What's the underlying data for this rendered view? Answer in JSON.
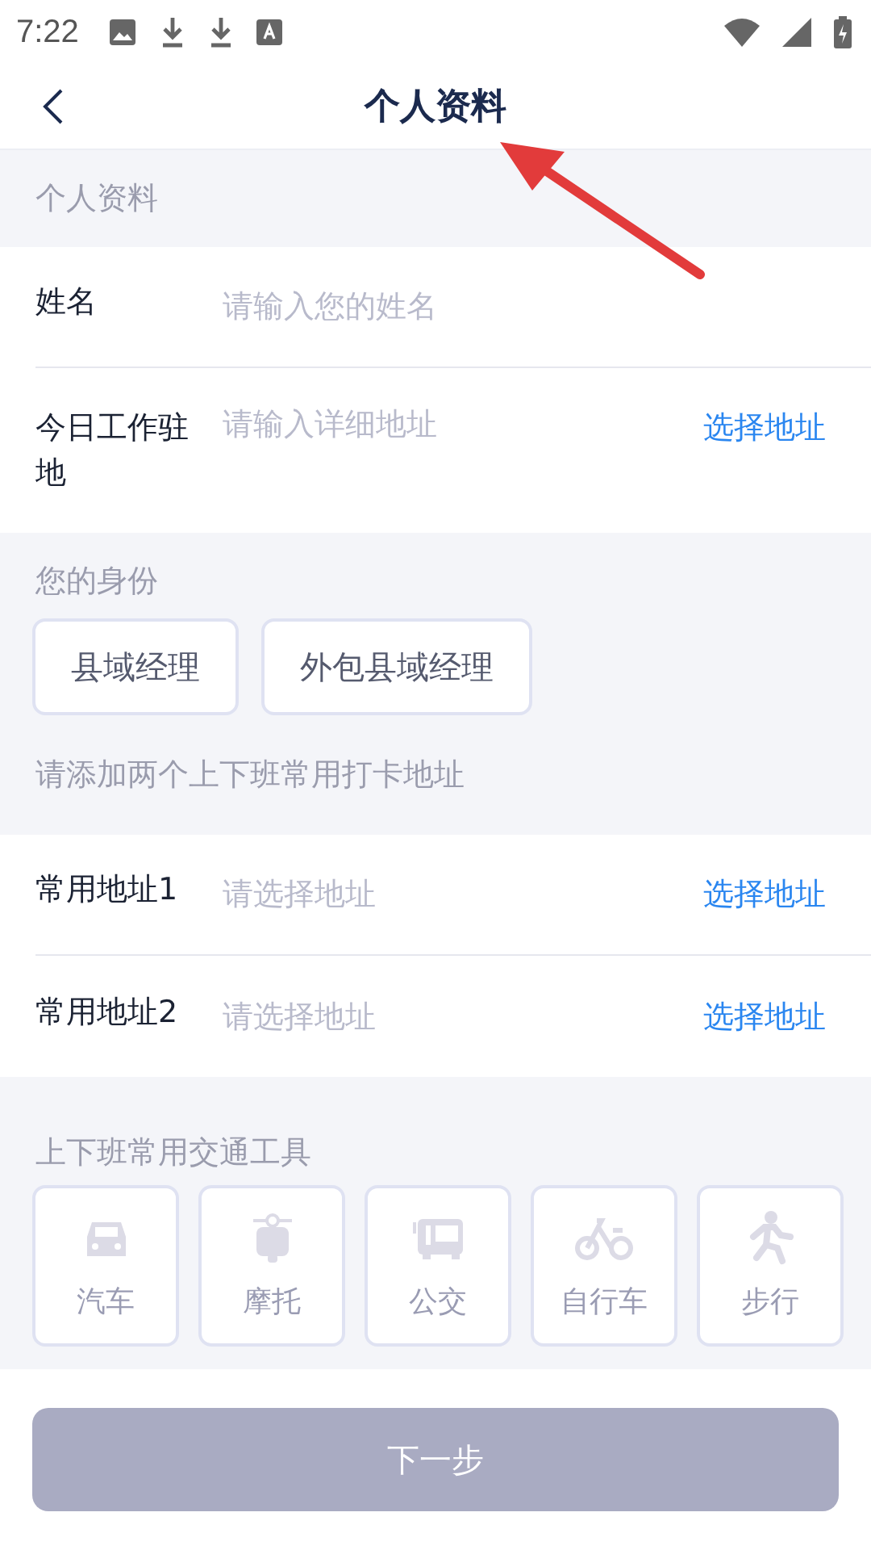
{
  "status_bar": {
    "time": "7:22"
  },
  "header": {
    "title": "个人资料"
  },
  "profile": {
    "section_title": "个人资料",
    "fields": [
      {
        "label": "姓名",
        "placeholder": "请输入您的姓名"
      },
      {
        "label": "今日工作驻地",
        "placeholder": "请输入详细地址",
        "action": "选择地址"
      }
    ]
  },
  "identity": {
    "section_title": "您的身份",
    "options": [
      {
        "label": "县域经理",
        "selected": false
      },
      {
        "label": "外包县域经理",
        "selected": false
      }
    ]
  },
  "addresses": {
    "section_title": "请添加两个上下班常用打卡地址",
    "fields": [
      {
        "label": "常用地址1",
        "placeholder": "请选择地址",
        "action": "选择地址"
      },
      {
        "label": "常用地址2",
        "placeholder": "请选择地址",
        "action": "选择地址"
      }
    ]
  },
  "transport": {
    "section_title": "上下班常用交通工具",
    "options": [
      {
        "kind": "car",
        "label": "汽车",
        "selected": false
      },
      {
        "kind": "motorbike",
        "label": "摩托",
        "selected": false
      },
      {
        "kind": "bus",
        "label": "公交",
        "selected": false
      },
      {
        "kind": "bicycle",
        "label": "自行车",
        "selected": false
      },
      {
        "kind": "walk",
        "label": "步行",
        "selected": false
      }
    ]
  },
  "next_button": {
    "label": "下一步",
    "disabled": true
  }
}
